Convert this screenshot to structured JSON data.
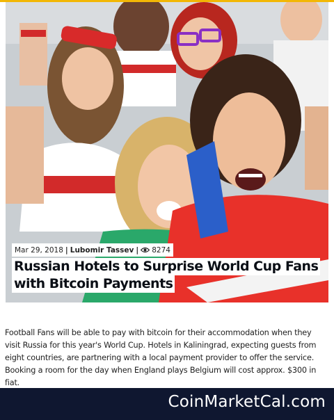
{
  "colors": {
    "accent": "#f2b705",
    "footer_bg": "#0f1730",
    "title_text": "#0b0f16"
  },
  "hero": {
    "image_description_icon": "photo"
  },
  "meta": {
    "date": "Mar 29, 2018",
    "separator": "|",
    "author": "Lubomir Tassev",
    "views_icon": "eye-icon",
    "views": "8274"
  },
  "title": {
    "line1": "Russian Hotels to Surprise World Cup Fans",
    "line2": "with Bitcoin Payments"
  },
  "description": "Football Fans will be able to pay with bitcoin for their accommodation when they visit Russia for this year's World Cup. Hotels in Kaliningrad, expecting guests from eight countries, are partnering with a local payment provider to offer the service. Booking a room for the day when England plays Belgium will cost approx. $300 in fiat.",
  "footer": {
    "brand": "CoinMarketCal.com"
  }
}
